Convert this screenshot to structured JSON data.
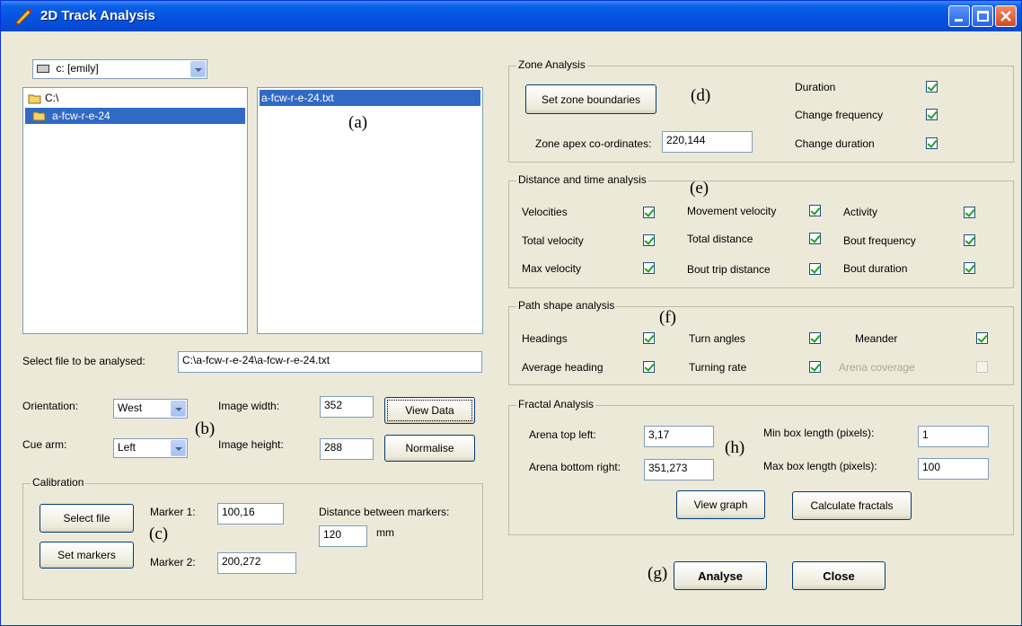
{
  "window": {
    "title": "2D Track Analysis"
  },
  "drive": {
    "value": "c: [emily]"
  },
  "folders": [
    {
      "label": "C:\\"
    },
    {
      "label": "a-fcw-r-e-24"
    }
  ],
  "files": [
    {
      "label": "a-fcw-r-e-24.txt"
    }
  ],
  "annotations": {
    "a": "(a)",
    "b": "(b)",
    "c": "(c)",
    "d": "(d)",
    "e": "(e)",
    "f": "(f)",
    "g": "(g)",
    "h": "(h)"
  },
  "file_select": {
    "label": "Select file to be analysed:",
    "value": "C:\\a-fcw-r-e-24\\a-fcw-r-e-24.txt"
  },
  "settings": {
    "orientation_label": "Orientation:",
    "orientation_value": "West",
    "cue_label": "Cue arm:",
    "cue_value": "Left",
    "width_label": "Image width:",
    "width_value": "352",
    "height_label": "Image height:",
    "height_value": "288",
    "view_data": "View Data",
    "normalise": "Normalise"
  },
  "calibration": {
    "title": "Calibration",
    "select_file": "Select file",
    "set_markers": "Set markers",
    "marker1_label": "Marker 1:",
    "marker1_value": "100,16",
    "marker2_label": "Marker 2:",
    "marker2_value": "200,272",
    "distance_label": "Distance between markers:",
    "distance_value": "120",
    "unit": "mm"
  },
  "zone": {
    "title": "Zone Analysis",
    "set_boundaries": "Set zone boundaries",
    "apex_label": "Zone apex co-ordinates:",
    "apex_value": "220,144",
    "options": [
      {
        "label": "Duration",
        "checked": true
      },
      {
        "label": "Change frequency",
        "checked": true
      },
      {
        "label": "Change duration",
        "checked": true
      }
    ]
  },
  "distance": {
    "title": "Distance and time analysis",
    "options": [
      {
        "label": "Velocities",
        "checked": true
      },
      {
        "label": "Total velocity",
        "checked": true
      },
      {
        "label": "Max velocity",
        "checked": true
      },
      {
        "label": "Movement velocity",
        "checked": true
      },
      {
        "label": "Total distance",
        "checked": true
      },
      {
        "label": "Bout trip distance",
        "checked": true
      },
      {
        "label": "Activity",
        "checked": true
      },
      {
        "label": "Bout frequency",
        "checked": true
      },
      {
        "label": "Bout duration",
        "checked": true
      }
    ]
  },
  "path": {
    "title": "Path shape analysis",
    "options": [
      {
        "label": "Headings",
        "checked": true
      },
      {
        "label": "Average heading",
        "checked": true
      },
      {
        "label": "Turn angles",
        "checked": true
      },
      {
        "label": "Turning rate",
        "checked": true
      },
      {
        "label": "Meander",
        "checked": true
      },
      {
        "label": "Arena coverage",
        "checked": false
      }
    ]
  },
  "fractal": {
    "title": "Fractal Analysis",
    "top_left_label": "Arena top left:",
    "top_left_value": "3,17",
    "bottom_right_label": "Arena bottom right:",
    "bottom_right_value": "351,273",
    "min_box_label": "Min box length (pixels):",
    "min_box_value": "1",
    "max_box_label": "Max box length (pixels):",
    "max_box_value": "100",
    "view_graph": "View  graph",
    "calculate": "Calculate fractals"
  },
  "actions": {
    "analyse": "Analyse",
    "close": "Close"
  }
}
